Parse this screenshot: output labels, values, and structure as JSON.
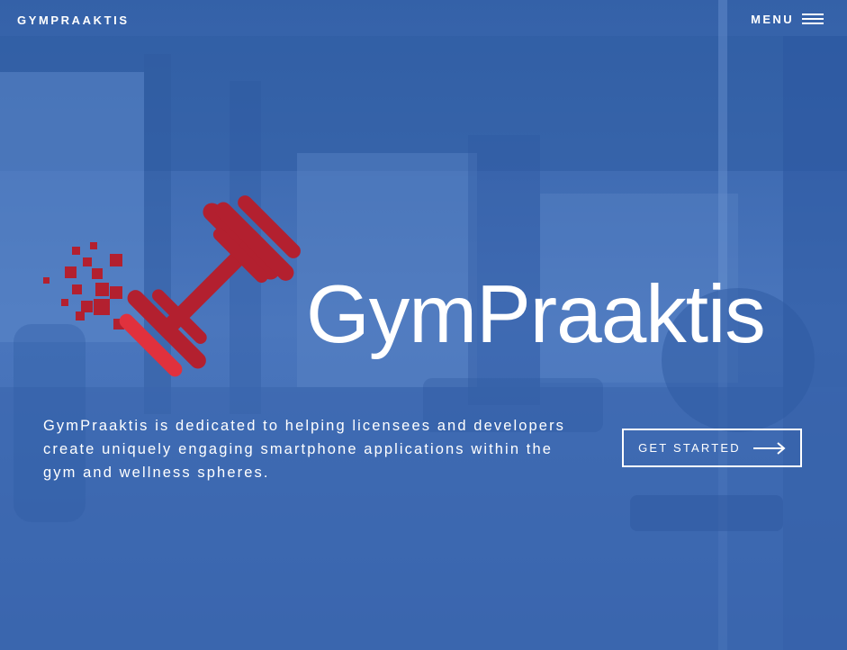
{
  "header": {
    "brand": "GYMPRAAKTIS",
    "menu_label": "MENU",
    "menu_icon": "hamburger-icon"
  },
  "hero": {
    "logo_icon": "dumbbell-logo-icon",
    "title": "GymPraaktis",
    "tagline": "GymPraaktis is dedicated to helping licensees and developers create uniquely engaging smartphone applications within the gym and wellness spheres.",
    "cta_label": "GET STARTED",
    "cta_icon": "arrow-right-icon"
  },
  "colors": {
    "overlay": "#3e68b0",
    "logo_red": "#b3202f",
    "logo_red_light": "#e0313d",
    "text": "#ffffff"
  }
}
